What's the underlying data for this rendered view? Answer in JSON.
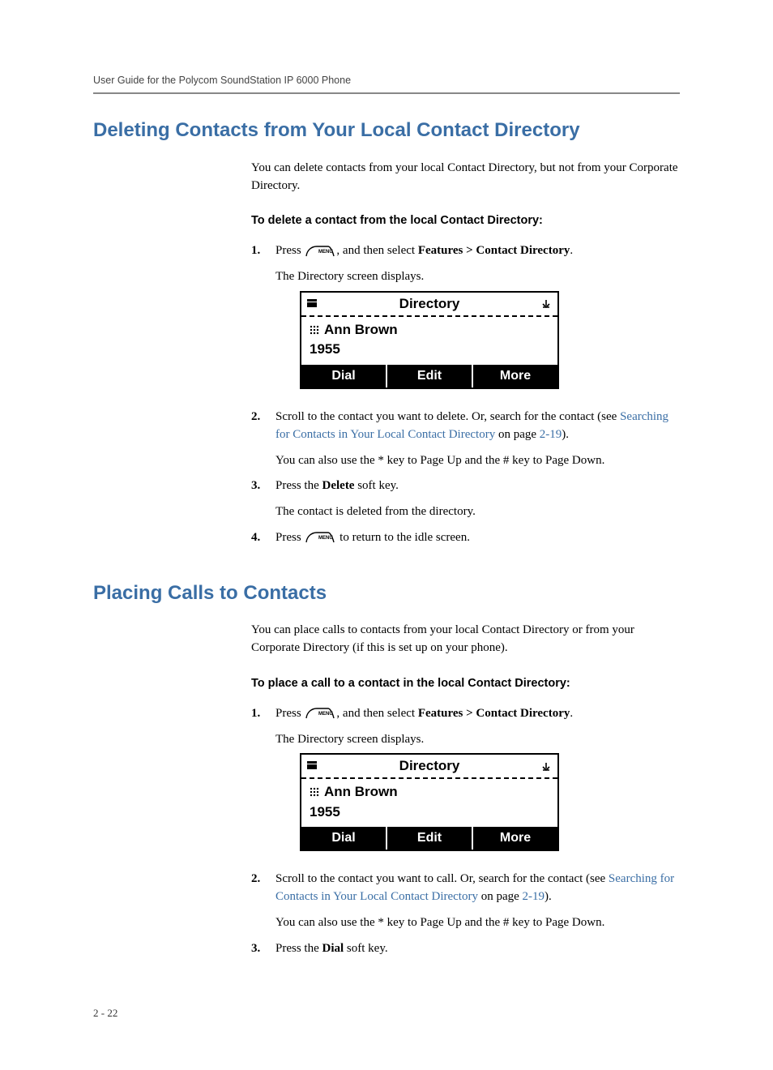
{
  "header": "User Guide for the Polycom SoundStation IP 6000 Phone",
  "sections": [
    {
      "title": "Deleting Contacts from Your Local Contact Directory",
      "intro": "You can delete contacts from your local Contact Directory, but not from your Corporate Directory.",
      "subhead": "To delete a contact from the local Contact Directory:",
      "step1_press": "Press ",
      "step1_menu_after": ", and then select ",
      "step1_features": "Features",
      "step1_gt": " > ",
      "step1_cd": "Contact Directory",
      "step1_period": ".",
      "step1_sub": "The Directory screen displays.",
      "lcd": {
        "title": "Directory",
        "name": "Ann Brown",
        "number": "1955",
        "soft": [
          "Dial",
          "Edit",
          "More"
        ]
      },
      "step2_a": "Scroll to the contact you want to delete. Or, search for the contact (see ",
      "step2_link": "Searching for Contacts in Your Local Contact Directory",
      "step2_b": " on page ",
      "step2_page": "2-19",
      "step2_c": ").",
      "step2_sub": "You can also use the * key to Page Up and the # key to Page Down.",
      "step3_a": "Press the ",
      "step3_key": "Delete",
      "step3_b": " soft key.",
      "step3_sub": "The contact is deleted from the directory.",
      "step4_a": "Press ",
      "step4_b": " to return to the idle screen."
    },
    {
      "title": "Placing Calls to Contacts",
      "intro": "You can place calls to contacts from your local Contact Directory or from your Corporate Directory (if this is set up on your phone).",
      "subhead": "To place a call to a contact in the local Contact Directory:",
      "step1_press": "Press ",
      "step1_menu_after": ", and then select ",
      "step1_features": "Features",
      "step1_gt": " > ",
      "step1_cd": "Contact Directory",
      "step1_period": ".",
      "step1_sub": "The Directory screen displays.",
      "lcd": {
        "title": "Directory",
        "name": "Ann Brown",
        "number": "1955",
        "soft": [
          "Dial",
          "Edit",
          "More"
        ]
      },
      "step2_a": "Scroll to the contact you want to call. Or, search for the contact (see ",
      "step2_link": "Searching for Contacts in Your Local Contact Directory",
      "step2_b": " on page ",
      "step2_page": "2-19",
      "step2_c": ").",
      "step2_sub": "You can also use the * key to Page Up and the # key to Page Down.",
      "step3_a": "Press the ",
      "step3_key": "Dial",
      "step3_b": " soft key."
    }
  ],
  "footer": "2 - 22",
  "numbers": {
    "n1": "1.",
    "n2": "2.",
    "n3": "3.",
    "n4": "4."
  }
}
